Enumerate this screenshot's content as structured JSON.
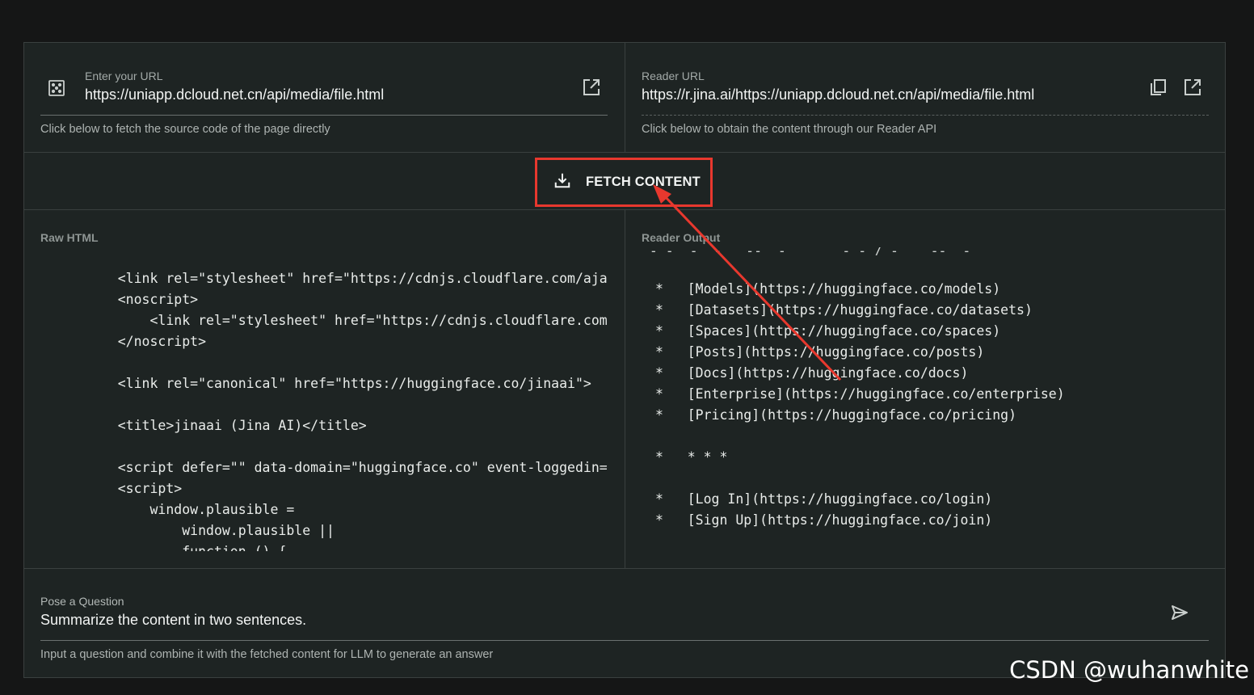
{
  "url_panel": {
    "label": "Enter your URL",
    "value": "https://uniapp.dcloud.net.cn/api/media/file.html",
    "hint": "Click below to fetch the source code of the page directly",
    "left_icon": "dice-icon",
    "open_icon": "external-link-icon"
  },
  "reader_panel": {
    "label": "Reader URL",
    "value": "https://r.jina.ai/https://uniapp.dcloud.net.cn/api/media/file.html",
    "hint": "Click below to obtain the content through our Reader API",
    "copy_icon": "copy-icon",
    "open_icon": "external-link-icon"
  },
  "fetch_button": {
    "label": "FETCH CONTENT",
    "icon": "download-icon",
    "highlight_color": "#e8382e"
  },
  "raw_html": {
    "title": "Raw HTML",
    "lines": [
      "    <link rel=\"stylesheet\" href=\"https://cdnjs.cloudflare.com/ajax/libs/",
      "    <noscript>",
      "        <link rel=\"stylesheet\" href=\"https://cdnjs.cloudflare.com/ajax/l",
      "    </noscript>",
      "",
      "    <link rel=\"canonical\" href=\"https://huggingface.co/jinaai\">",
      "",
      "    <title>jinaai (Jina AI)</title>",
      "",
      "    <script defer=\"\" data-domain=\"huggingface.co\" event-loggedin=\"false\"",
      "    <script>",
      "        window.plausible =",
      "            window.plausible ||",
      "            function () {"
    ]
  },
  "reader_output": {
    "title": "Reader Output",
    "lines": [
      "*   [Models](https://huggingface.co/models)",
      "*   [Datasets](https://huggingface.co/datasets)",
      "*   [Spaces](https://huggingface.co/spaces)",
      "*   [Posts](https://huggingface.co/posts)",
      "*   [Docs](https://huggingface.co/docs)",
      "*   [Enterprise](https://huggingface.co/enterprise)",
      "*   [Pricing](https://huggingface.co/pricing)",
      "",
      "*   * * *",
      "",
      "*   [Log In](https://huggingface.co/login)",
      "*   [Sign Up](https://huggingface.co/join)"
    ]
  },
  "question_panel": {
    "label": "Pose a Question",
    "value": "Summarize the content in two sentences.",
    "hint": "Input a question and combine it with the fetched content for LLM to generate an answer",
    "send_icon": "send-icon"
  },
  "watermark": "CSDN @wuhanwhite",
  "colors": {
    "background": "#151616",
    "panel": "#1e2423",
    "border": "#3a403f",
    "annotation": "#e8382e"
  }
}
